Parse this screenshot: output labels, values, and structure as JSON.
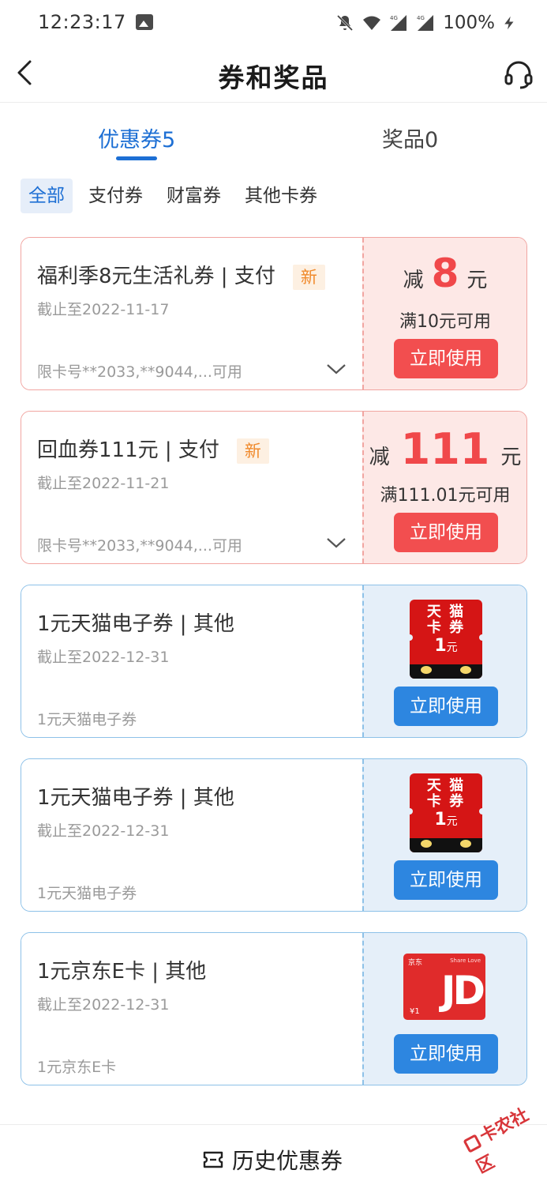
{
  "status_bar": {
    "time": "12:23:17",
    "battery": "100%",
    "network_1": "4G",
    "network_2": "4G"
  },
  "header": {
    "title": "券和奖品"
  },
  "tabs": [
    {
      "label": "优惠券5",
      "active": true
    },
    {
      "label": "奖品0",
      "active": false
    }
  ],
  "filters": [
    {
      "label": "全部",
      "active": true
    },
    {
      "label": "支付券",
      "active": false
    },
    {
      "label": "财富券",
      "active": false
    },
    {
      "label": "其他卡券",
      "active": false
    }
  ],
  "coupons": [
    {
      "style": "red",
      "title": "福利季8元生活礼券 | 支付",
      "badge": "新",
      "date": "截止至2022-11-17",
      "limit": "限卡号**2033,**9044,...可用",
      "amount_prefix": "减",
      "amount": "8",
      "amount_unit": "元",
      "threshold": "满10元可用",
      "button": "立即使用"
    },
    {
      "style": "red",
      "title": "回血券111元 | 支付",
      "badge": "新",
      "date": "截止至2022-11-21",
      "limit": "限卡号**2033,**9044,...可用",
      "amount_prefix": "减",
      "amount": "111",
      "amount_unit": "元",
      "threshold": "满111.01元可用",
      "button": "立即使用"
    },
    {
      "style": "blue",
      "title": "1元天猫电子券 | 其他",
      "date": "截止至2022-12-31",
      "limit": "1元天猫电子券",
      "image_line1": "天 猫",
      "image_line2": "卡 券",
      "image_value": "1",
      "image_unit": "元",
      "button": "立即使用"
    },
    {
      "style": "blue",
      "title": "1元天猫电子券 | 其他",
      "date": "截止至2022-12-31",
      "limit": "1元天猫电子券",
      "image_line1": "天 猫",
      "image_line2": "卡 券",
      "image_value": "1",
      "image_unit": "元",
      "button": "立即使用"
    },
    {
      "style": "blue",
      "title": "1元京东E卡 | 其他",
      "date": "截止至2022-12-31",
      "limit": "1元京东E卡",
      "image_brand": "京东",
      "image_tag": "Share Love",
      "image_big": "JD",
      "image_value": "¥1",
      "button": "立即使用"
    }
  ],
  "footer": {
    "history_label": "历史优惠券"
  },
  "watermark": {
    "text": "卡农社区"
  },
  "colors": {
    "accent_blue": "#1d6fd4",
    "button_red": "#f24e4f",
    "button_blue": "#2d86e0",
    "amount_red": "#f0484a",
    "badge_orange": "#f08a2c"
  }
}
